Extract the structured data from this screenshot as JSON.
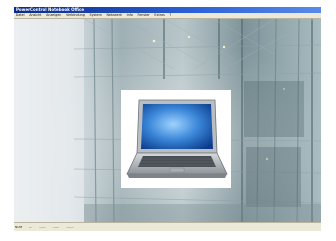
{
  "window": {
    "title": "PowerControl Notebook Office"
  },
  "menu": {
    "items": [
      {
        "label": "Datei"
      },
      {
        "label": "Ansicht"
      },
      {
        "label": "Anzeigen"
      },
      {
        "label": "Verbindung"
      },
      {
        "label": "System"
      },
      {
        "label": "Netzwerk"
      },
      {
        "label": "Info"
      },
      {
        "label": "Fenster"
      },
      {
        "label": "Extras"
      },
      {
        "label": "?"
      }
    ]
  },
  "status": {
    "left": "NUM",
    "segments": [
      "---",
      "------",
      "------",
      "-------"
    ]
  },
  "icons": {
    "product_image": "laptop-icon"
  }
}
